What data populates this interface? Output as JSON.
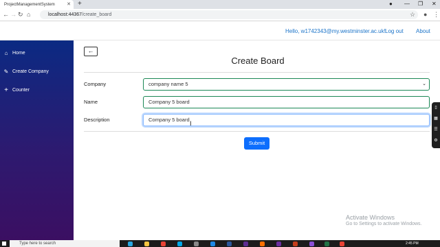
{
  "browser": {
    "tab_title": "ProjectManagementSystem",
    "tab_close_icon": "close-icon",
    "new_tab_label": "+",
    "url_host": "localhost:44367",
    "url_path": "/create_board"
  },
  "navbar": {
    "greeting": "Hello, w1742343@my.westminster.ac.uk!",
    "logout": "Log out",
    "about": "About"
  },
  "sidebar": {
    "items": [
      {
        "label": "Home",
        "icon": "home-icon"
      },
      {
        "label": "Create Company",
        "icon": "pencil-icon"
      },
      {
        "label": "Counter",
        "icon": "plus-icon"
      }
    ]
  },
  "page": {
    "back_icon": "arrow-left-icon",
    "title": "Create Board"
  },
  "form": {
    "company_label": "Company",
    "company_value": "company name 5",
    "name_label": "Name",
    "name_value": "Company 5 board",
    "description_label": "Description",
    "description_value": "Company 5 board",
    "submit_label": "Submit"
  },
  "watermark": {
    "title": "Activate Windows",
    "subtitle": "Go to Settings to activate Windows."
  },
  "taskbar": {
    "search_placeholder": "Type here to search",
    "time": "2:45 PM"
  },
  "colors": {
    "sidebar_top": "#0b2a83",
    "sidebar_bottom": "#3b0f62",
    "primary": "#0d6efd",
    "valid_border": "#198754",
    "link": "#1a73c8"
  }
}
